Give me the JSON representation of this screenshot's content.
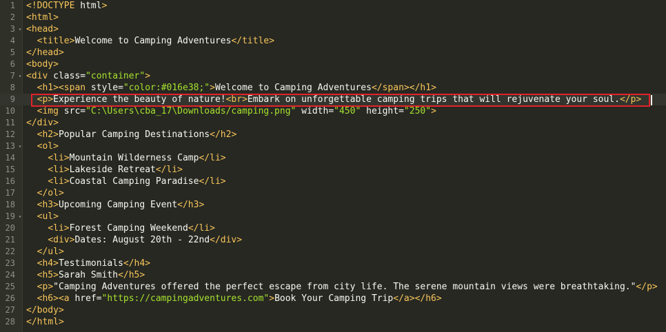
{
  "editor": {
    "fold_marker": "▾",
    "lines": [
      {
        "num": "1",
        "fold": "",
        "code": "<!DOCTYPE html>"
      },
      {
        "num": "2",
        "fold": "",
        "code": "<html>"
      },
      {
        "num": "3",
        "fold": "▾",
        "code": "<head>"
      },
      {
        "num": "4",
        "fold": "",
        "code": "  <title>Welcome to Camping Adventures</title>"
      },
      {
        "num": "5",
        "fold": "",
        "code": "</head>"
      },
      {
        "num": "6",
        "fold": "",
        "code": "<body>"
      },
      {
        "num": "7",
        "fold": "▾",
        "code": "<div class=\"container\">"
      },
      {
        "num": "8",
        "fold": "",
        "code": "  <h1><span style=\"color:#016e38;\">Welcome to Camping Adventures</span></h1>"
      },
      {
        "num": "9",
        "fold": "",
        "code": "  <p>Experience the beauty of nature!<br>Embark on unforgettable camping trips that will rejuvenate your soul.</p>"
      },
      {
        "num": "10",
        "fold": "",
        "code": "  <img src=\"C:\\Users\\cba_17\\Downloads/camping.png\" width=\"450\" height=\"250\">"
      },
      {
        "num": "11",
        "fold": "",
        "code": "</div>"
      },
      {
        "num": "12",
        "fold": "",
        "code": "  <h2>Popular Camping Destinations</h2>"
      },
      {
        "num": "13",
        "fold": "▾",
        "code": "  <ol>"
      },
      {
        "num": "14",
        "fold": "",
        "code": "    <li>Mountain Wilderness Camp</li>"
      },
      {
        "num": "15",
        "fold": "",
        "code": "    <li>Lakeside Retreat</li>"
      },
      {
        "num": "16",
        "fold": "",
        "code": "    <li>Coastal Camping Paradise</li>"
      },
      {
        "num": "17",
        "fold": "",
        "code": "  </ol>"
      },
      {
        "num": "18",
        "fold": "",
        "code": "  <h3>Upcoming Camping Event</h3>"
      },
      {
        "num": "19",
        "fold": "▾",
        "code": "  <ul>"
      },
      {
        "num": "20",
        "fold": "",
        "code": "    <li>Forest Camping Weekend</li>"
      },
      {
        "num": "21",
        "fold": "",
        "code": "    <div>Dates: August 20th - 22nd</div>"
      },
      {
        "num": "22",
        "fold": "",
        "code": "  </ul>"
      },
      {
        "num": "23",
        "fold": "",
        "code": "  <h4>Testimonials</h4>"
      },
      {
        "num": "24",
        "fold": "",
        "code": "  <h5>Sarah Smith</h5>"
      },
      {
        "num": "25",
        "fold": "",
        "code": "  <p>\"Camping Adventures offered the perfect escape from city life. The serene mountain views were breathtaking.\"</p>"
      },
      {
        "num": "26",
        "fold": "",
        "code": "  <h6><a href=\"https://campingadventures.com\">Book Your Camping Trip</a></h6>"
      },
      {
        "num": "27",
        "fold": "",
        "code": "</body>"
      },
      {
        "num": "28",
        "fold": "",
        "code": "</html>"
      }
    ],
    "active_line": "9",
    "colors": {
      "background": "#272822",
      "gutter": "#2f3129",
      "line_number": "#8f908a",
      "text": "#f8f8f2",
      "tag": "#f8c65a",
      "string": "#a6e22e",
      "highlight_border": "#e3222a"
    }
  }
}
